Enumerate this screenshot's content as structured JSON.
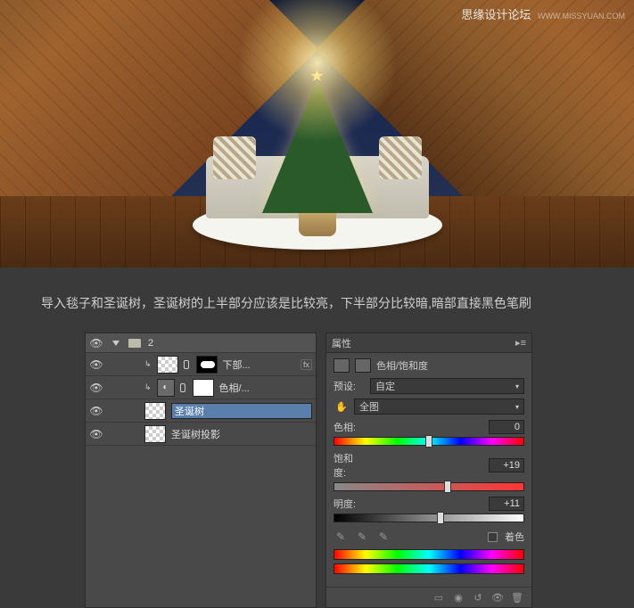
{
  "watermark": {
    "text": "思缘设计论坛",
    "url": "WWW.MISSYUAN.COM"
  },
  "caption": "导入毯子和圣诞树，圣诞树的上半部分应该是比较亮，下半部分比较暗,暗部直接黑色笔刷",
  "layers": {
    "group_name": "2",
    "items": [
      {
        "name": "下部...",
        "type": "mask",
        "fx": true
      },
      {
        "name": "色相/...",
        "type": "adjustment"
      },
      {
        "name": "圣诞树",
        "type": "layer",
        "selected": true
      },
      {
        "name": "圣诞树投影",
        "type": "layer"
      }
    ]
  },
  "properties": {
    "panel_title": "属性",
    "adjustment_name": "色相/饱和度",
    "preset_label": "预设:",
    "preset_value": "自定",
    "range_value": "全图",
    "sliders": {
      "hue": {
        "label": "色相:",
        "value": "0",
        "pos": 50
      },
      "saturation": {
        "label": "饱和度:",
        "value": "+19",
        "pos": 60
      },
      "lightness": {
        "label": "明度:",
        "value": "+11",
        "pos": 56
      }
    },
    "colorize_label": "着色"
  }
}
